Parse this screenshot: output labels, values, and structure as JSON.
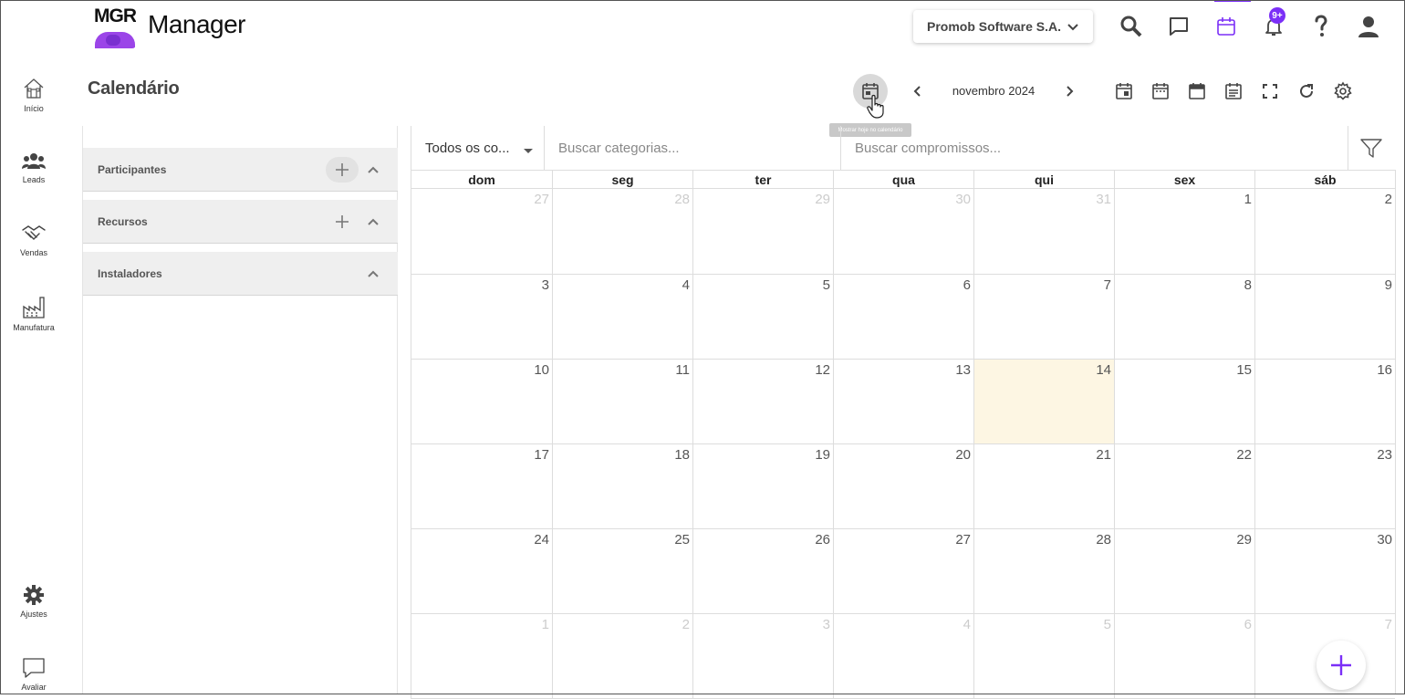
{
  "app": {
    "logo_text": "MGR",
    "name": "Manager",
    "company": "Promob Software S.A.",
    "notification_badge": "9+",
    "accent_color": "#7b2ff7"
  },
  "nav": [
    {
      "id": "inicio",
      "label": "Início",
      "icon": "home-icon"
    },
    {
      "id": "leads",
      "label": "Leads",
      "icon": "people-icon"
    },
    {
      "id": "vendas",
      "label": "Vendas",
      "icon": "handshake-icon"
    },
    {
      "id": "manufatura",
      "label": "Manufatura",
      "icon": "factory-icon"
    },
    {
      "id": "ajustes",
      "label": "Ajustes",
      "icon": "gear-icon"
    },
    {
      "id": "avaliar",
      "label": "Avaliar",
      "icon": "comment-icon"
    }
  ],
  "page": {
    "title": "Calendário",
    "month": "novembro 2024",
    "today_tooltip": "Mostrar hoje no calendário"
  },
  "sections": [
    {
      "name": "Participantes",
      "addable": true
    },
    {
      "name": "Recursos",
      "addable": true
    },
    {
      "name": "Instaladores",
      "addable": false
    }
  ],
  "filters": {
    "category_select": "Todos os co...",
    "search_categories_placeholder": "Buscar categorias...",
    "search_appointments_placeholder": "Buscar compromissos..."
  },
  "calendar": {
    "weekdays": [
      "dom",
      "seg",
      "ter",
      "qua",
      "qui",
      "sex",
      "sáb"
    ],
    "weeks": [
      [
        {
          "d": "27",
          "other": true
        },
        {
          "d": "28",
          "other": true
        },
        {
          "d": "29",
          "other": true
        },
        {
          "d": "30",
          "other": true
        },
        {
          "d": "31",
          "other": true
        },
        {
          "d": "1"
        },
        {
          "d": "2"
        }
      ],
      [
        {
          "d": "3"
        },
        {
          "d": "4"
        },
        {
          "d": "5"
        },
        {
          "d": "6"
        },
        {
          "d": "7"
        },
        {
          "d": "8"
        },
        {
          "d": "9"
        }
      ],
      [
        {
          "d": "10"
        },
        {
          "d": "11"
        },
        {
          "d": "12"
        },
        {
          "d": "13"
        },
        {
          "d": "14",
          "today": true
        },
        {
          "d": "15"
        },
        {
          "d": "16"
        }
      ],
      [
        {
          "d": "17"
        },
        {
          "d": "18"
        },
        {
          "d": "19"
        },
        {
          "d": "20"
        },
        {
          "d": "21"
        },
        {
          "d": "22"
        },
        {
          "d": "23"
        }
      ],
      [
        {
          "d": "24"
        },
        {
          "d": "25"
        },
        {
          "d": "26"
        },
        {
          "d": "27"
        },
        {
          "d": "28"
        },
        {
          "d": "29"
        },
        {
          "d": "30"
        }
      ],
      [
        {
          "d": "1",
          "other": true
        },
        {
          "d": "2",
          "other": true
        },
        {
          "d": "3",
          "other": true
        },
        {
          "d": "4",
          "other": true
        },
        {
          "d": "5",
          "other": true
        },
        {
          "d": "6",
          "other": true
        },
        {
          "d": "7",
          "other": true
        }
      ]
    ],
    "today_color": "#fdf6e3"
  }
}
